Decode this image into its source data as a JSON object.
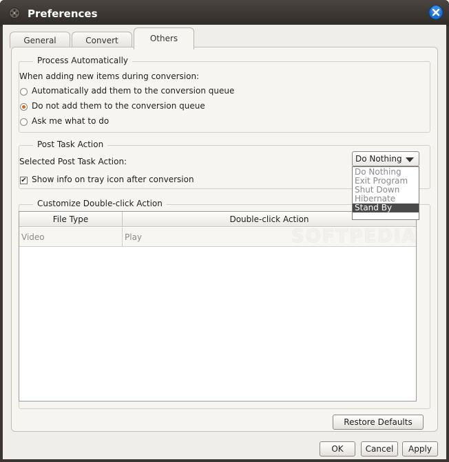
{
  "window": {
    "title": "Preferences",
    "app_icon": "film-reel-icon",
    "close_icon": "close-icon"
  },
  "tabs": [
    {
      "label": "General",
      "active": false
    },
    {
      "label": "Convert",
      "active": false
    },
    {
      "label": "Others",
      "active": true
    }
  ],
  "process_auto": {
    "legend": "Process Automatically",
    "prompt": "When adding new items during conversion:",
    "options": [
      {
        "label": "Automatically add them to the conversion queue",
        "checked": false
      },
      {
        "label": "Do not add them to the conversion queue",
        "checked": true
      },
      {
        "label": "Ask me what to do",
        "checked": false
      }
    ]
  },
  "post_task": {
    "legend": "Post Task Action",
    "label": "Selected Post Task Action:",
    "selected": "Do Nothing",
    "options": [
      "Do Nothing",
      "Exit Program",
      "Shut Down",
      "Hibernate",
      "Stand By"
    ],
    "highlighted_option": "Stand By",
    "show_info_label": "Show info on tray icon after conversion",
    "show_info_checked": true
  },
  "double_click": {
    "legend": "Customize Double-click Action",
    "columns": [
      "File Type",
      "Double-click Action"
    ],
    "rows": [
      {
        "file_type": "Video",
        "action": "Play"
      }
    ]
  },
  "buttons": {
    "restore_defaults": "Restore Defaults",
    "ok": "OK",
    "cancel": "Cancel",
    "apply": "Apply"
  },
  "watermark": "SOFTPEDIA",
  "colors": {
    "titlebar": "#3a3530",
    "radio_selected": "#d96b12",
    "dropdown_highlight": "#4a4a4a",
    "close_button": "#1c6fd6"
  }
}
